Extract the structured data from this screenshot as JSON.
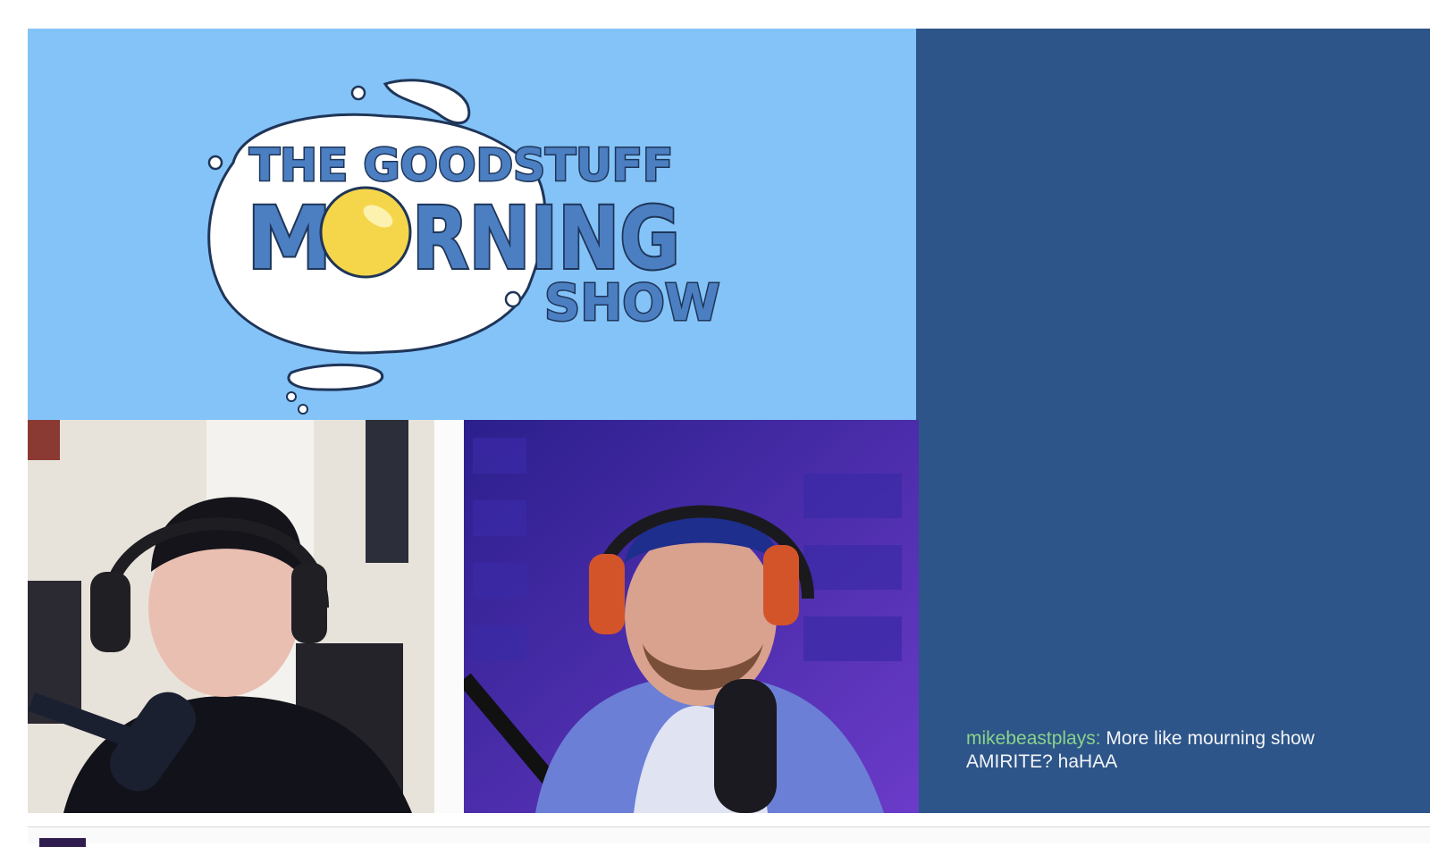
{
  "logo": {
    "line1": "THE GOODSTUFF",
    "line2_a": "M",
    "line2_b": "RNING",
    "line3": "SHOW"
  },
  "chat": {
    "username": "mikebeastplays:",
    "message": "More like mourning show AMIRITE? haHAA"
  },
  "colors": {
    "stream_background": "#2d5589",
    "logo_background": "#84c3f8",
    "logo_text": "#4b7fc2",
    "chat_username": "#8ad38a",
    "yolk": "#f5d64a"
  },
  "icons": {
    "host_left": "person-headset-icon",
    "host_right": "person-headset-icon",
    "egg": "fried-egg-icon"
  }
}
